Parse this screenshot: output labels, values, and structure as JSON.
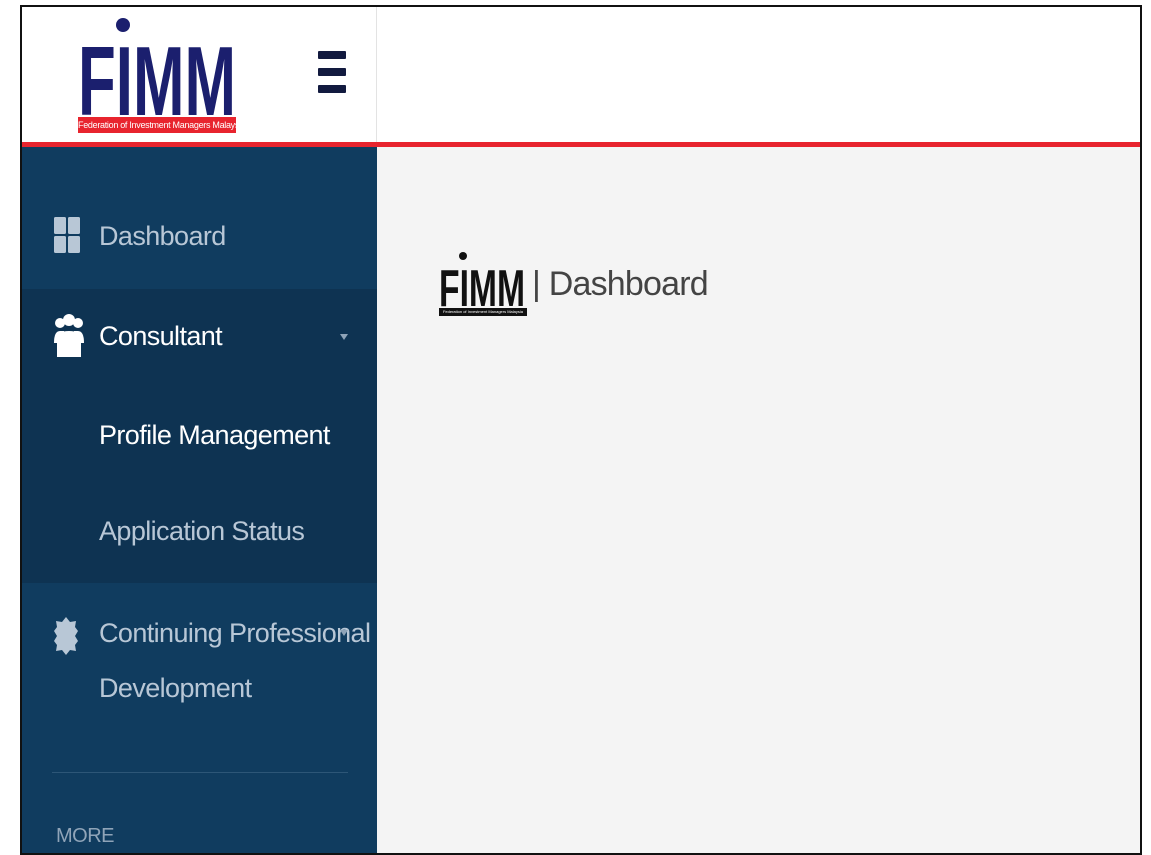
{
  "brand": {
    "name": "FIMM",
    "tagline": "Federation of Investment Managers Malaysia",
    "colors": {
      "navy": "#1b1f6e",
      "red": "#e8242e"
    }
  },
  "header": {
    "menu_icon": "hamburger-icon"
  },
  "sidebar": {
    "items": [
      {
        "label": "Dashboard",
        "icon": "dashboard-grid-icon"
      },
      {
        "label": "Consultant",
        "icon": "users-group-icon",
        "expanded": true
      },
      {
        "label": "Profile Management"
      },
      {
        "label": "Application Status"
      },
      {
        "label": "Continuing Professional",
        "label_line2": "Development",
        "icon": "gear-badge-icon"
      }
    ],
    "section_label": "MORE",
    "colors": {
      "background": "#103c5f",
      "active": "#0e3352",
      "text": "#b8c7d6",
      "active_text": "#ffffff"
    }
  },
  "main": {
    "page_title": "Dashboard",
    "logo_separator": "|"
  }
}
